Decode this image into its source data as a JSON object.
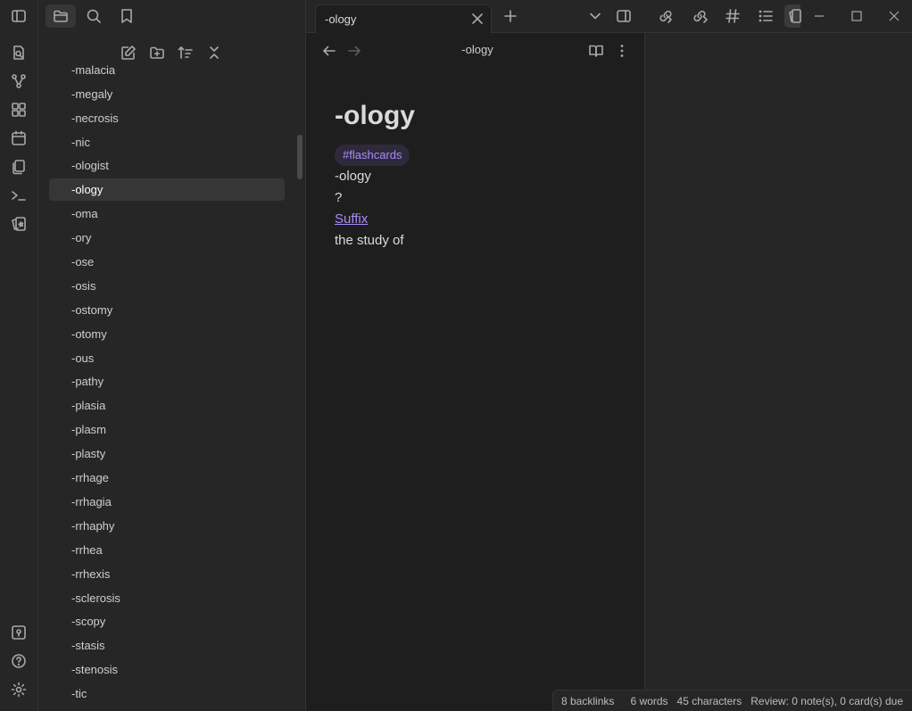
{
  "window": {
    "tab_title": "-ology"
  },
  "editor": {
    "view_title": "-ology",
    "note": {
      "title": "-ology",
      "tag": "#flashcards",
      "line1": "-ology",
      "line2": "?",
      "link": "Suffix",
      "line3": "the study of"
    }
  },
  "file_tree": {
    "items": [
      "-malacia",
      "-megaly",
      "-necrosis",
      "-nic",
      "-ologist",
      "-ology",
      "-oma",
      "-ory",
      "-ose",
      "-osis",
      "-ostomy",
      "-otomy",
      "-ous",
      "-pathy",
      "-plasia",
      "-plasm",
      "-plasty",
      "-rrhage",
      "-rrhagia",
      "-rrhaphy",
      "-rrhea",
      "-rrhexis",
      "-sclerosis",
      "-scopy",
      "-stasis",
      "-stenosis",
      "-tic"
    ],
    "active_item": "-ology"
  },
  "status_bar": {
    "backlinks": "8 backlinks",
    "words": "6 words",
    "characters": "45 characters",
    "review": "Review: 0 note(s), 0 card(s) due"
  },
  "icons": {
    "ribbon": [
      "sidebar-toggle-icon",
      "quick-switcher-icon",
      "graph-view-icon",
      "canvas-icon",
      "daily-note-icon",
      "templates-icon",
      "command-palette-icon",
      "flashcards-icon",
      "vault-icon",
      "help-icon",
      "settings-icon"
    ],
    "right_tools": [
      "backlinks-icon",
      "outgoing-links-icon",
      "tags-icon",
      "outline-icon",
      "bookmark-panel-icon"
    ]
  },
  "colors": {
    "accent": "#a88bfa",
    "background": "#1e1e1e",
    "panel": "#262626"
  }
}
